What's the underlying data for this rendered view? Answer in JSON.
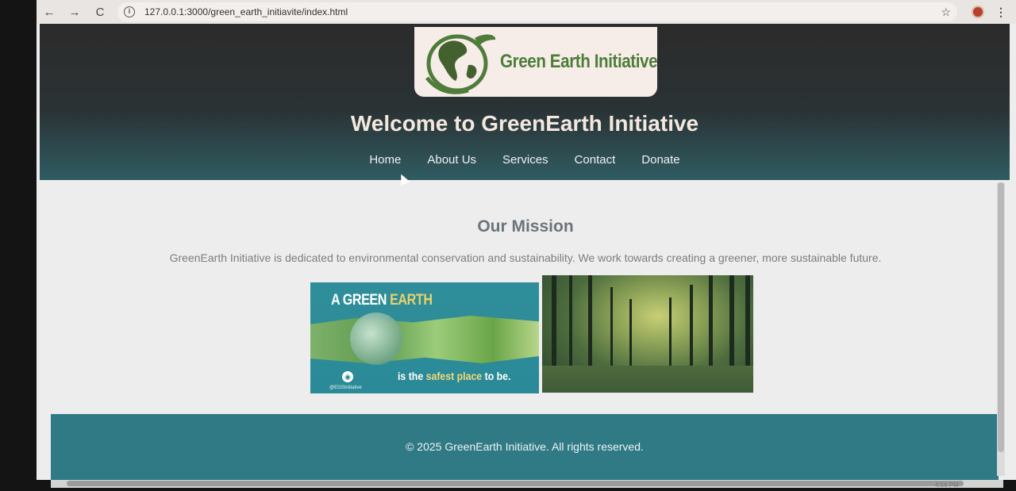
{
  "browser": {
    "url": "127.0.0.1:3000/green_earth_initiavite/index.html",
    "back_icon": "←",
    "forward_icon": "→",
    "reload_icon": "C",
    "info_icon": "i",
    "star_icon": "☆",
    "menu_icon": "⋮"
  },
  "header": {
    "logo_text": "Green Earth Initiative",
    "title": "Welcome to GreenEarth Initiative",
    "nav": [
      {
        "label": "Home"
      },
      {
        "label": "About Us"
      },
      {
        "label": "Services"
      },
      {
        "label": "Contact"
      },
      {
        "label": "Donate"
      }
    ]
  },
  "main": {
    "mission_title": "Our Mission",
    "mission_text": "GreenEarth Initiative is dedicated to environmental conservation and sustainability. We work towards creating a greener, more sustainable future.",
    "banner": {
      "headline_prefix": "A GREEN ",
      "headline_accent": "EARTH",
      "tagline_prefix": "is the ",
      "tagline_accent": "safest place",
      "tagline_suffix": " to be.",
      "handle": "@EGSInitiative"
    }
  },
  "footer": {
    "copyright": "© 2025 GreenEarth Initiative. All rights reserved."
  },
  "taskbar": {
    "clock": "4:56 PM"
  },
  "colors": {
    "header_dark": "#2c2b2b",
    "header_teal": "#2f5c62",
    "footer": "#2f7a85",
    "logo_green": "#4e7d3a",
    "title": "#f4e7de"
  }
}
